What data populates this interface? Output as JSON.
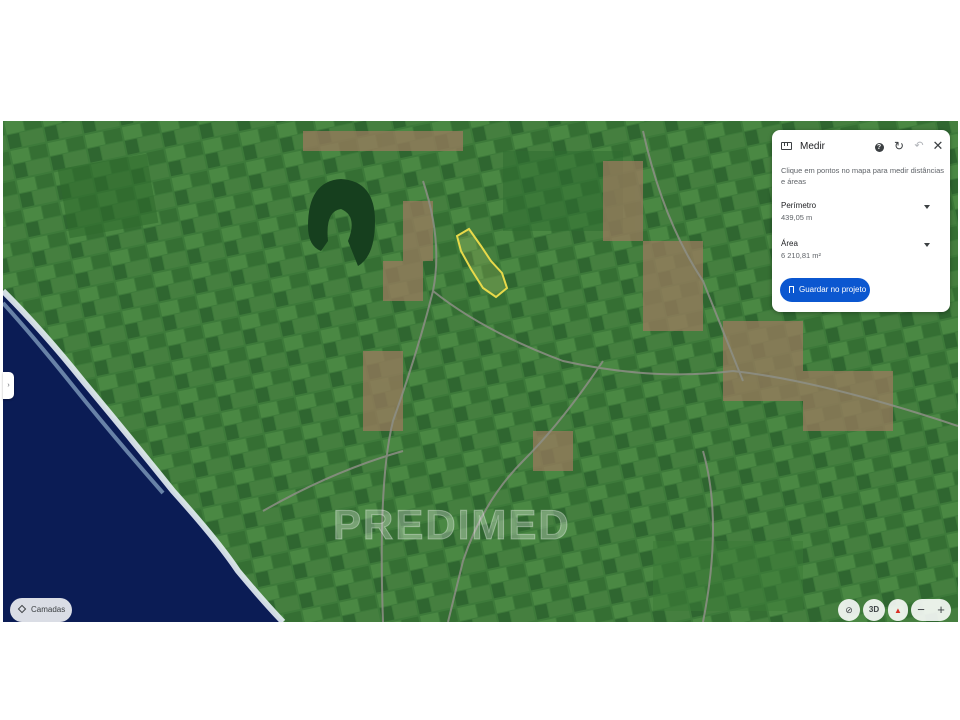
{
  "map": {
    "watermark": "PREDIMED"
  },
  "measure_panel": {
    "title": "Medir",
    "help_symbol": "?",
    "refresh_symbol": "↻",
    "undo_symbol": "↶",
    "close_symbol": "✕",
    "instructions": "Clique em pontos no mapa para medir distâncias e áreas",
    "perimeter": {
      "label": "Perímetro",
      "value": "439,05 m"
    },
    "area": {
      "label": "Área",
      "value": "6 210,81 m²"
    },
    "save_label": "Guardar no projeto",
    "accent_color": "#0b57d0"
  },
  "side_tab": {
    "symbol": "›"
  },
  "layers": {
    "label": "Camadas"
  },
  "controls": {
    "no_location_symbol": "⊘",
    "view_3d_label": "3D",
    "compass_symbol": "▲",
    "zoom_out_label": "−",
    "zoom_in_label": "+"
  },
  "icons": [
    "ruler-icon",
    "help-icon",
    "refresh-icon",
    "undo-icon",
    "close-icon",
    "bookmark-icon",
    "layers-icon",
    "chevron-right-icon",
    "location-off-icon",
    "compass-icon"
  ]
}
